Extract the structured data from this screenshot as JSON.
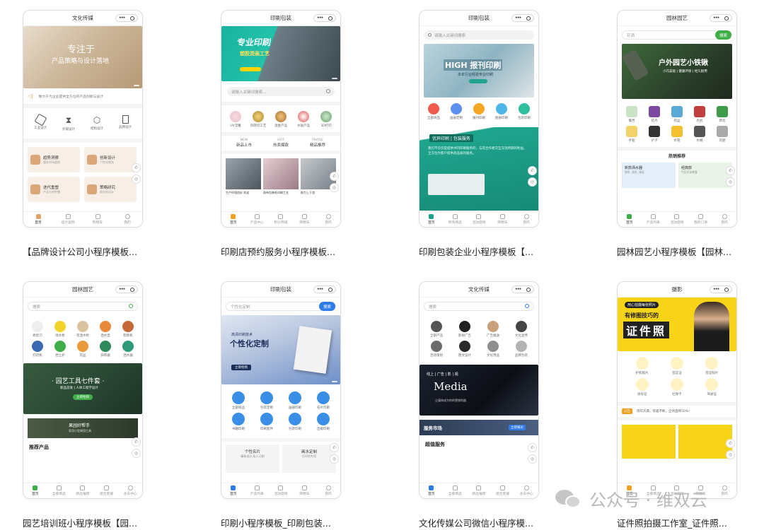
{
  "cards": [
    {
      "caption": "【品牌设计公司小程序模板...",
      "header": "文化传媒",
      "banner_title": "专注于",
      "banner_sub": "产品策略与设计落地",
      "notice": "致力于为企业提供全方位的产品创新与设计",
      "icons": [
        "工业设计",
        "外观设计",
        "结构设计",
        "品牌设计"
      ],
      "services": [
        {
          "title": "趋势洞察",
          "sub": "服务市场趋势"
        },
        {
          "title": "创新设计",
          "sub": "个性化服务"
        },
        {
          "title": "迭代重塑",
          "sub": "产品与的传播"
        },
        {
          "title": "策略研究",
          "sub": "商业的设计"
        }
      ],
      "tabs": [
        "首页",
        "设计案例",
        "购物车",
        "我的"
      ]
    },
    {
      "caption": "印刷店预约服务小程序模板...",
      "header": "印刷包装",
      "banner_title": "专业印刷",
      "banner_sub": "塑胶烫画工艺",
      "search_placeholder": "请输入关键词搜索...",
      "icons": [
        "UV浮雕",
        "热转印工艺",
        "烫金产品",
        "水贴产品",
        "3D打印"
      ],
      "promos": [
        {
          "tag": "NEW",
          "label": "新品上市"
        },
        {
          "tag": "HOT",
          "label": "热卖爆款"
        },
        {
          "tag": "PRAISE",
          "label": "精品推荐"
        }
      ],
      "products": [
        "生产环境良好 欢迎",
        "雨布包装纸印刷工艺",
        "助力上下游"
      ],
      "tabs": [
        "首页",
        "产品中心",
        "积分商城",
        "购物车",
        "我的"
      ]
    },
    {
      "caption": "印刷包装企业小程序模板【...",
      "header": "印刷包装",
      "search_placeholder": "请输入关键词搜索",
      "banner_title": "HIGH 报刊印刷",
      "banner_sub": "多年行业经验专业印刷",
      "icons": [
        "全部商品",
        "画册定制",
        "报刊印刷",
        "图册印刷",
        "包装印刷"
      ],
      "feature_title": "优异印刷 | 包装服务",
      "feature_text": "我们不仅仅是提供书刊印刷服务的，与其合作者交互交流所期的利益，全方位为客户提供高品质的服务。",
      "tabs": [
        "首页",
        "所有商品",
        "活动促销",
        "购物车",
        "我的"
      ]
    },
    {
      "caption": "园林园艺小程序模板【园林...",
      "header": "园林园艺",
      "search_placeholder": "花洒",
      "search_button": "搜索",
      "banner_title": "户外园艺小铁锹",
      "banner_sub": "小巧美观 | 健康环保 | 经久耐用",
      "icons": [
        "篱笆",
        "花卉",
        "花盆",
        "农机",
        "草剪",
        "手套",
        "铲子",
        "水管",
        "水桶",
        "花肥"
      ],
      "hot_title": "热销推荐",
      "hot_items": [
        {
          "title": "新款洒水器",
          "sub": "洗车, 浇花, 清洁"
        },
        {
          "title": "经典款",
          "sub": "气压式水喷壶"
        }
      ],
      "tabs": [
        "首页",
        "产品列表",
        "活动促销",
        "我的订单",
        "我的"
      ]
    },
    {
      "caption": "园艺培训班小程序模板【园...",
      "header": "园林园艺",
      "search_placeholder": "搜索",
      "icons": [
        "修剪刀",
        "喷水枪",
        "花洒水枪",
        "洒水壶",
        "割草机",
        "打药机",
        "挡土护",
        "花盆",
        "骑草器",
        "洒水器"
      ],
      "banner_title": "· 园艺工具七件套 ·",
      "banner_sub": "新品首发 | 人体工程学设计",
      "banner_button": "立即抢购",
      "strip_title": "果园好帮手",
      "strip_sub": "家用小型果园工具",
      "section_title": "推荐产品",
      "tabs": [
        "首页",
        "全部商品",
        "新品推荐",
        "组合套餐",
        "会员中心"
      ]
    },
    {
      "caption": "印刷小程序模板_印刷包装...",
      "header": "印刷包装",
      "search_placeholder": "个性化定制",
      "search_button": "搜索",
      "banner_sub": "高清印刷技术",
      "banner_title": "个性化定制",
      "banner_button": "立即抢购",
      "icons": [
        "全部商品",
        "包装定制",
        "画册印刷",
        "名片印刷",
        "书籍印刷",
        "印刷套件",
        "包装印刷",
        "出版印刷"
      ],
      "cards": [
        {
          "title": "个性名片",
          "sub": "精致设计,私人订制"
        },
        {
          "title": "画水定制",
          "sub": "打印机专用"
        }
      ],
      "tabs": [
        "首页",
        "产品列表",
        "活动促销",
        "购物车",
        "我的"
      ]
    },
    {
      "caption": "文化传媒公司微信小程序模...",
      "header": "文化传媒",
      "search_placeholder": "搜索",
      "icons": [
        "全部产品",
        "影视广告",
        "广告推送",
        "文化宣传",
        "活动策划",
        "图文设计",
        "文化用品",
        "品牌包装"
      ],
      "banner_top": "线上 | 广告 | 影 | 视",
      "banner_title": "Media",
      "banner_sub": "让媒体成为你的营销利器",
      "market_title": "服务市场",
      "market_button": "立即报价",
      "section_title": "超值服务",
      "tabs": [
        "首页",
        "全部商品",
        "新品推荐",
        "组合套餐",
        "会员中心"
      ]
    },
    {
      "caption": "证件照拍摄工作室_证件照...",
      "header": "摄影",
      "banner_tag": "用心拍摄每张照片",
      "banner_sub": "有修图技巧的",
      "banner_title": "证件照",
      "icons": [
        "护照照片",
        "签证证",
        "签证照片",
        "身份证",
        "社保卡",
        "驾驶证"
      ],
      "notice_tag": "公告",
      "notice": "周年庆典，惊喜不断，全场直降50%！",
      "tabs": [
        "首页",
        "全部商品",
        "活动促销",
        "购物车",
        "我的"
      ]
    }
  ],
  "watermark": "公众号 · 维双云"
}
